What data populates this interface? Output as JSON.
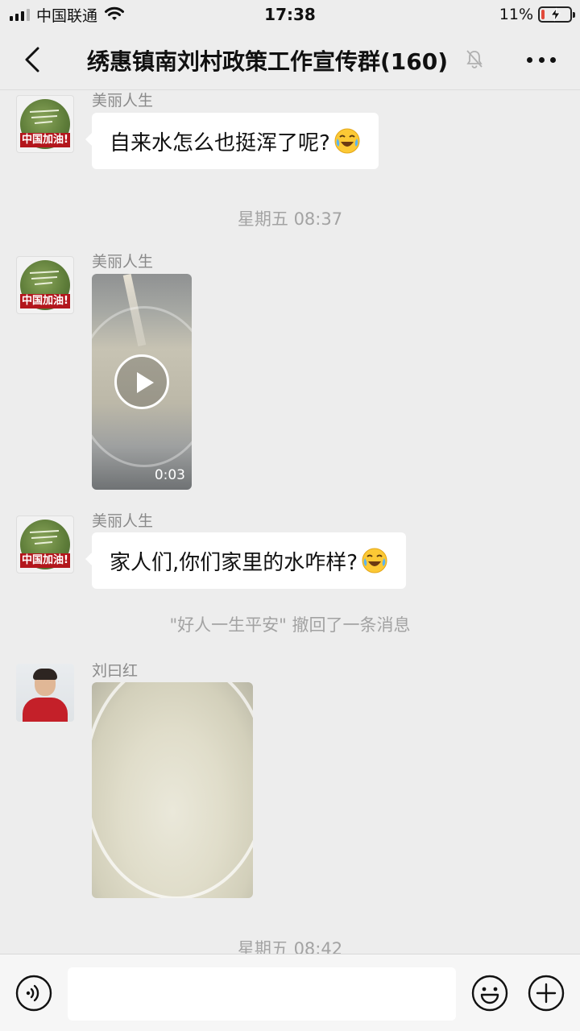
{
  "status_bar": {
    "carrier": "中国联通",
    "time": "17:38",
    "battery_percent": "11%",
    "battery_level": 0.11
  },
  "header": {
    "title": "绣惠镇南刘村政策工作宣传群(160)",
    "back_icon": "chevron-left-icon",
    "mute_icon": "bell-mute-icon",
    "more_icon": "more-dots-icon"
  },
  "messages": {
    "msg1": {
      "sender": "美丽人生",
      "text": "自来水怎么也挺浑了呢?",
      "emoji": "crying-laughing-emoji"
    },
    "ts1": "星期五 08:37",
    "msg2": {
      "sender": "美丽人生",
      "type": "video",
      "duration": "0:03"
    },
    "msg3": {
      "sender": "美丽人生",
      "text": "家人们,你们家里的水咋样?",
      "emoji": "crying-laughing-emoji"
    },
    "recall": "\"好人一生平安\" 撤回了一条消息",
    "msg4": {
      "sender": "刘曰红",
      "type": "image"
    },
    "ts2": "星期五 08:42"
  },
  "avatars": {
    "meili_banner": "中国加油!"
  },
  "input_bar": {
    "placeholder": "",
    "voice_icon": "voice-icon",
    "emoji_icon": "emoji-icon",
    "plus_icon": "plus-icon"
  },
  "colors": {
    "background": "#ededed",
    "bubble": "#ffffff",
    "battery_low": "#e24a3b",
    "avatar_banner": "#b3161c"
  }
}
